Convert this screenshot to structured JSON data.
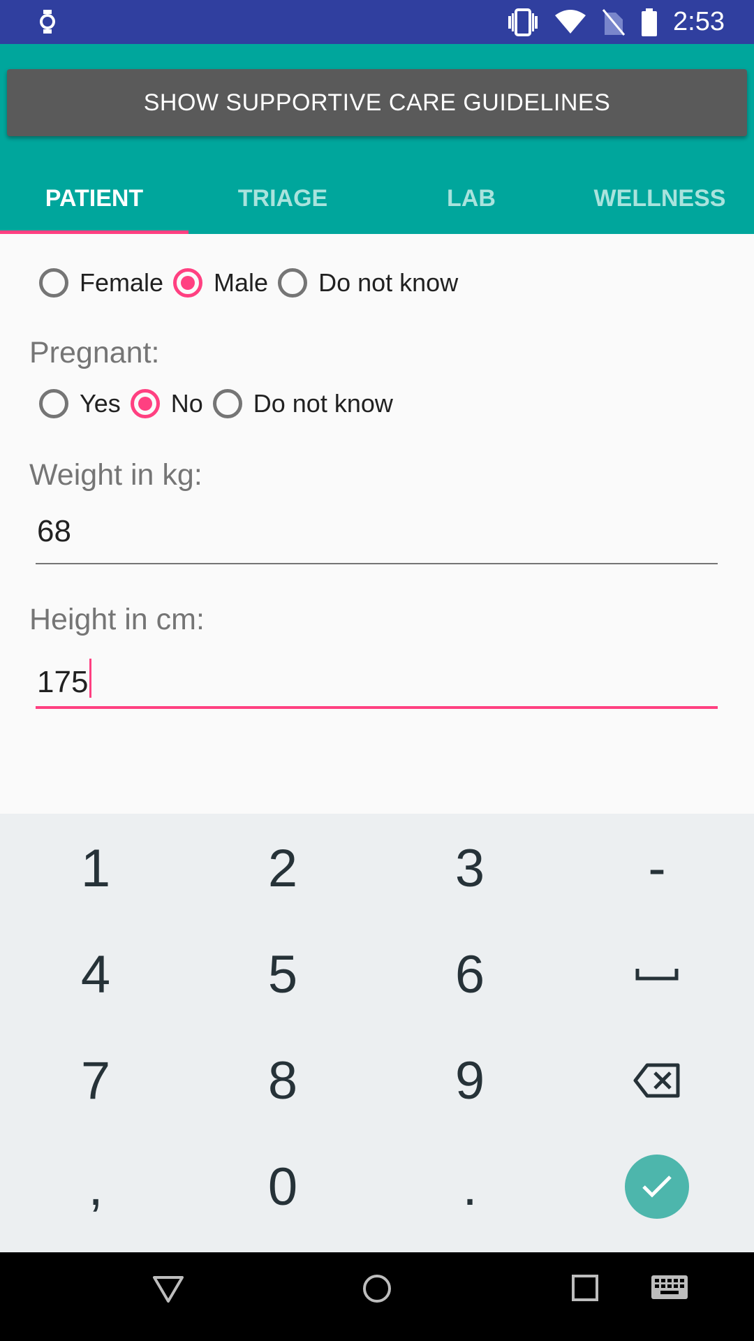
{
  "status_bar": {
    "time": "2:53",
    "icons": [
      "watch-icon",
      "vibrate-icon",
      "wifi-icon",
      "no-sim-icon",
      "battery-icon"
    ]
  },
  "header": {
    "guidelines_button": "SHOW SUPPORTIVE CARE GUIDELINES",
    "tabs": [
      {
        "label": "PATIENT",
        "active": true
      },
      {
        "label": "TRIAGE",
        "active": false
      },
      {
        "label": "LAB",
        "active": false
      },
      {
        "label": "WELLNESS",
        "active": false
      }
    ]
  },
  "form": {
    "sex_options": [
      {
        "label": "Female",
        "checked": false
      },
      {
        "label": "Male",
        "checked": true
      },
      {
        "label": "Do not know",
        "checked": false
      }
    ],
    "pregnant_label": "Pregnant:",
    "pregnant_options": [
      {
        "label": "Yes",
        "checked": false
      },
      {
        "label": "No",
        "checked": true
      },
      {
        "label": "Do not know",
        "checked": false
      }
    ],
    "weight_label": "Weight in kg:",
    "weight_value": "68",
    "height_label": "Height in cm:",
    "height_value": "175"
  },
  "keyboard": {
    "keys": [
      "1",
      "2",
      "3",
      "-",
      "4",
      "5",
      "6",
      "space",
      "7",
      "8",
      "9",
      "delete",
      ",",
      "0",
      ".",
      "done"
    ]
  },
  "colors": {
    "status_bar": "#303f9f",
    "app_bar": "#00a69c",
    "accent": "#ff4081",
    "button": "#5a5a5a",
    "keyboard_bg": "#eceff1",
    "enter_key": "#4db6ac"
  },
  "nav_bar": {
    "icons": [
      "back-icon",
      "home-icon",
      "recents-icon",
      "keyboard-icon"
    ]
  }
}
